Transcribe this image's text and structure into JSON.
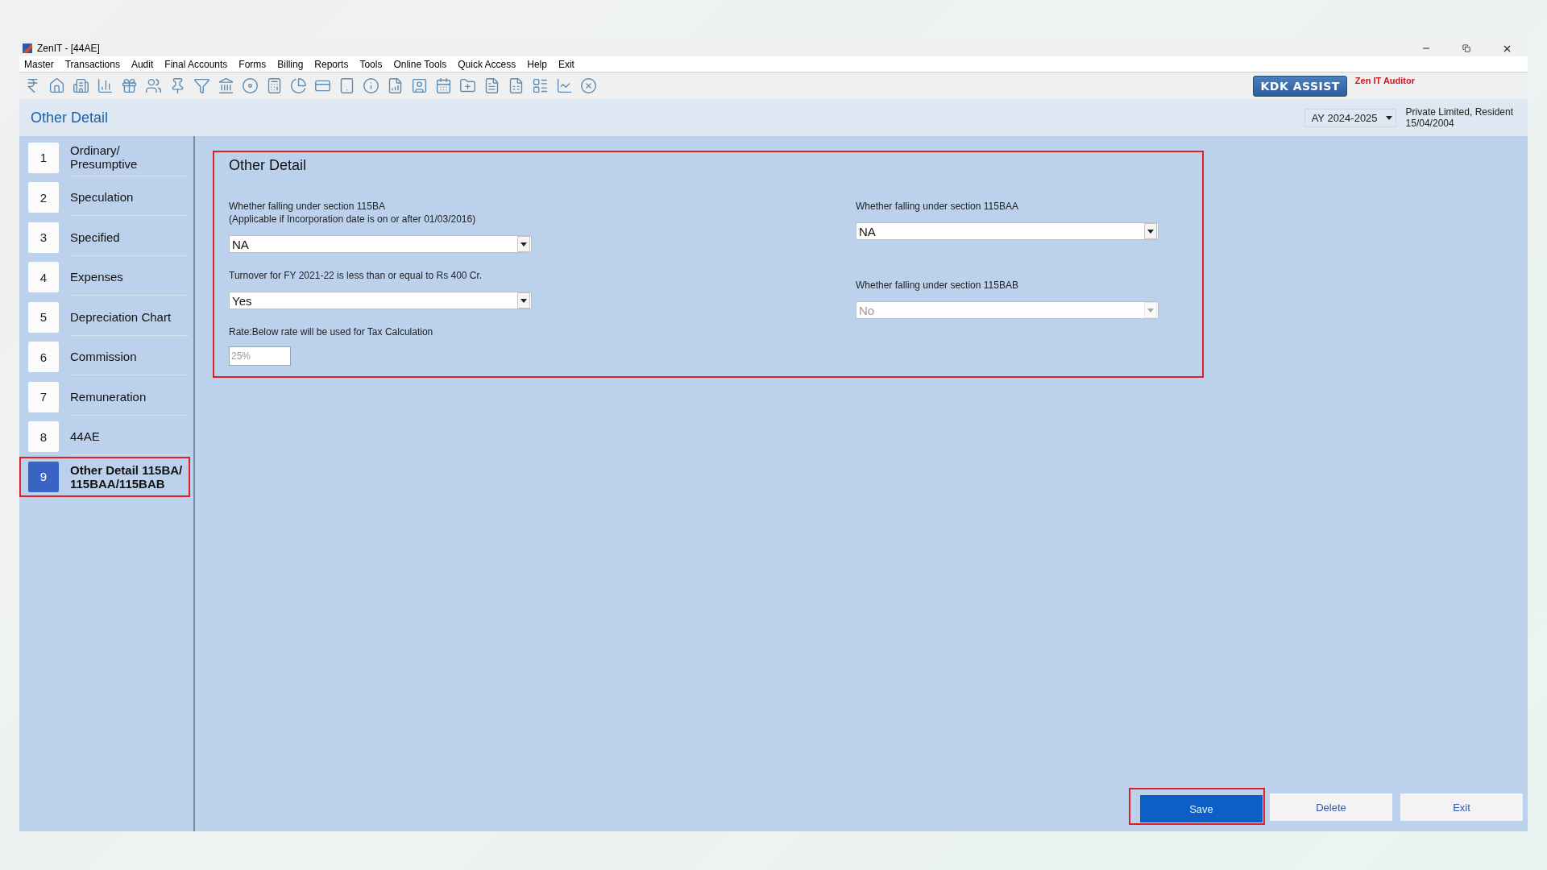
{
  "window": {
    "title": "ZenIT - [44AE]"
  },
  "menu": [
    "Master",
    "Transactions",
    "Audit",
    "Final Accounts",
    "Forms",
    "Billing",
    "Reports",
    "Tools",
    "Online Tools",
    "Quick Access",
    "Help",
    "Exit"
  ],
  "header": {
    "title": "Other Detail",
    "assessment_year": "AY 2024-2025",
    "entity": "Private Limited, Resident",
    "date": "15/04/2004",
    "assist_button": "KDK ASSIST",
    "brand": "Zen IT Auditor"
  },
  "sidebar": {
    "items": [
      {
        "number": "1",
        "label": "Ordinary/ Presumptive",
        "selected": false,
        "highlighted": false
      },
      {
        "number": "2",
        "label": "Speculation",
        "selected": false,
        "highlighted": false
      },
      {
        "number": "3",
        "label": "Specified",
        "selected": false,
        "highlighted": false
      },
      {
        "number": "4",
        "label": "Expenses",
        "selected": false,
        "highlighted": false
      },
      {
        "number": "5",
        "label": "Depreciation Chart",
        "selected": false,
        "highlighted": false
      },
      {
        "number": "6",
        "label": "Commission",
        "selected": false,
        "highlighted": false
      },
      {
        "number": "7",
        "label": "Remuneration",
        "selected": false,
        "highlighted": false
      },
      {
        "number": "8",
        "label": "44AE",
        "selected": false,
        "highlighted": false
      },
      {
        "number": "9",
        "label": "Other Detail 115BA/ 115BAA/115BAB",
        "selected": true,
        "highlighted": true
      }
    ]
  },
  "form": {
    "title": "Other Detail",
    "highlighted": true,
    "left": [
      {
        "kind": "select",
        "label": "Whether falling under section 115BA",
        "note": "(Applicable if Incorporation date is on or after 01/03/2016)",
        "value": "NA",
        "disabled": false
      },
      {
        "kind": "select",
        "label": "Turnover for FY 2021-22 is less than or equal to Rs 400 Cr.",
        "value": "Yes",
        "disabled": false
      },
      {
        "kind": "text",
        "label": "Rate:Below rate will be used for Tax Calculation",
        "value": "25%",
        "disabled": true
      }
    ],
    "right": [
      {
        "kind": "select",
        "label": "Whether falling under section 115BAA",
        "value": "NA",
        "disabled": false
      },
      {
        "kind": "select",
        "label": "Whether falling under section 115BAB",
        "value": "No",
        "disabled": true
      }
    ]
  },
  "buttons": [
    {
      "label": "Save",
      "primary": true,
      "highlighted": true
    },
    {
      "label": "Delete",
      "primary": false,
      "highlighted": false
    },
    {
      "label": "Exit",
      "primary": false,
      "highlighted": false
    }
  ]
}
